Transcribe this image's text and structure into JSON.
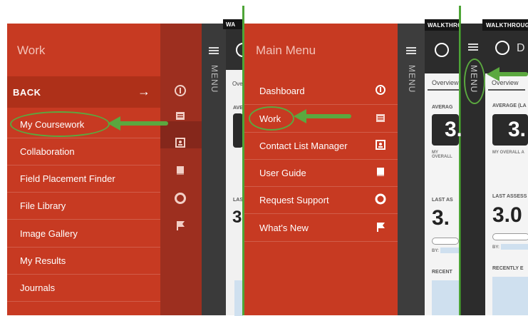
{
  "panel1": {
    "title": "Work",
    "back_label": "BACK",
    "back_arrow": "→",
    "items": [
      "My Coursework",
      "Collaboration",
      "Field Placement Finder",
      "File Library",
      "Image Gallery",
      "My Results",
      "Journals"
    ],
    "rail_menu_label": "MENU"
  },
  "panel2": {
    "title": "Main Menu",
    "items": [
      {
        "label": "Dashboard",
        "icon": "logo-icon"
      },
      {
        "label": "Work",
        "icon": "briefcase-icon"
      },
      {
        "label": "Contact List Manager",
        "icon": "contact-card-icon"
      },
      {
        "label": "User Guide",
        "icon": "book-icon"
      },
      {
        "label": "Request Support",
        "icon": "lifebuoy-icon"
      },
      {
        "label": "What's New",
        "icon": "flag-icon"
      }
    ],
    "rail_menu_label": "MENU"
  },
  "dashboard": {
    "walkthrough_label": "WALKTHROUGH",
    "walkthrough_short": "WALKTHROU",
    "walk_cut1": "WA",
    "walk_cut2": "WALKTHRO",
    "tab_overview": "Overview",
    "tab_overview_short": "Overv",
    "average_label": "AVERAGE (LA",
    "average_short": "AVERAG",
    "average_cut1": "AVER",
    "average_value": "3.",
    "my_overall": "MY OVERALL A",
    "my_overall_short": "MY OVERALL",
    "last_assess": "LAST ASSESS",
    "last_assess_short": "LAST AS",
    "last_cut": "LAS",
    "last_value": "3.0",
    "last_value_short": "3.",
    "by_label": "BY:",
    "recently": "RECENTLY E",
    "recently_short": "RECENT",
    "header_letter": "D",
    "menu_label": "MENU"
  },
  "colors": {
    "menu_red": "#c73a22",
    "back_red": "#ae3019",
    "rail_red": "#9d2f1f",
    "annotation_green": "#5ba83f"
  }
}
